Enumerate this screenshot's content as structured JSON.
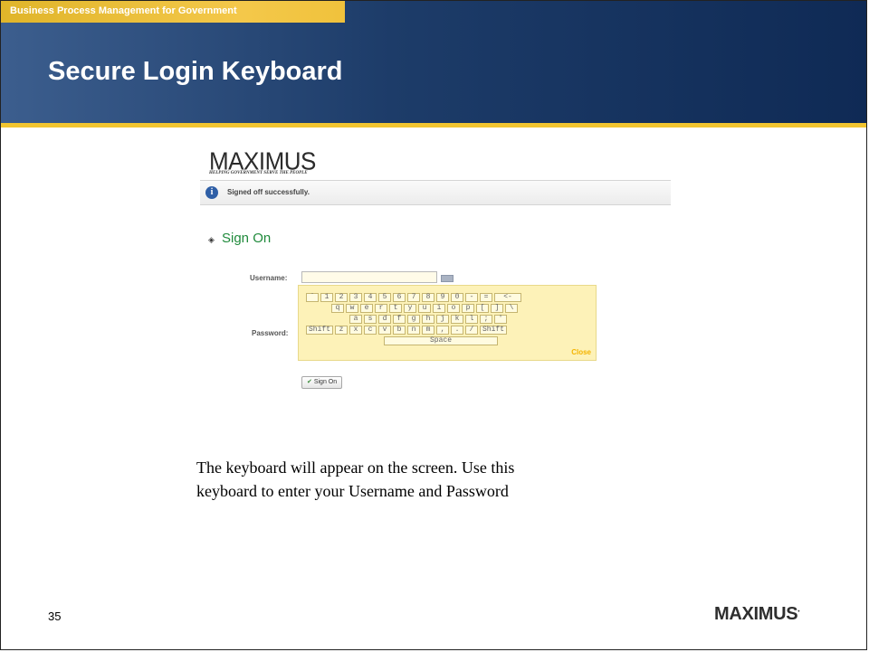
{
  "slide": {
    "header_tab": "Business Process Management for Government",
    "title": "Secure Login Keyboard",
    "caption_line1": "The keyboard will appear on the screen.  Use this",
    "caption_line2": "keyboard to enter your Username and Password",
    "page_number": "35",
    "footer_logo": "MAXIMUS",
    "colors": {
      "header_blue": "#1d3c69",
      "accent_gold": "#f2c530"
    }
  },
  "screenshot": {
    "logo": "MAXIMUS",
    "logo_tagline": "HELPING GOVERNMENT SERVE THE PEOPLE",
    "info_icon": "info-icon",
    "message": "Signed off successfully.",
    "section_title": "Sign On",
    "username_label": "Username:",
    "password_label": "Password:",
    "username_value": "",
    "keyboard": {
      "rows": [
        [
          "`",
          "1",
          "2",
          "3",
          "4",
          "5",
          "6",
          "7",
          "8",
          "9",
          "0",
          "-",
          "=",
          "<-"
        ],
        [
          "q",
          "w",
          "e",
          "r",
          "t",
          "y",
          "u",
          "i",
          "o",
          "p",
          "[",
          "]",
          "\\"
        ],
        [
          "a",
          "s",
          "d",
          "f",
          "g",
          "h",
          "j",
          "k",
          "l",
          ";",
          "'"
        ],
        [
          "Shift",
          "z",
          "x",
          "c",
          "v",
          "b",
          "n",
          "m",
          ",",
          ".",
          "/",
          "Shift"
        ]
      ],
      "space_label": "Space",
      "close_label": "Close"
    },
    "signon_button": "Sign On"
  }
}
